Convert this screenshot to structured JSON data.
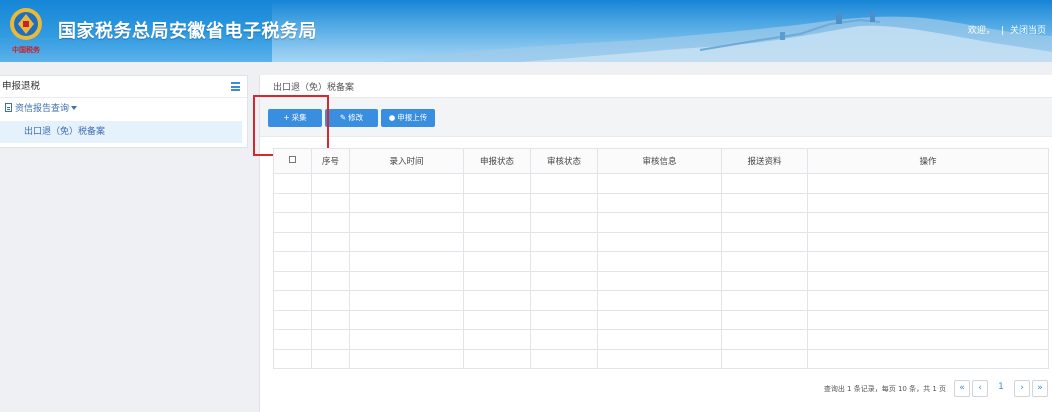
{
  "header": {
    "site_title": "国家税务总局安徽省电子税务局",
    "welcome": "欢迎，",
    "separator": "|",
    "close_page": "关闭当页",
    "brand_color": "#1585d6"
  },
  "sidebar": {
    "title": "申报退税",
    "menu_icon": "hamburger-icon",
    "group": {
      "label": "资信报告查询",
      "icon": "document-icon"
    },
    "items": [
      {
        "label": "出口退（免）税备案"
      }
    ]
  },
  "main": {
    "breadcrumb": "出口退（免）税备案",
    "toolbar": {
      "collect": {
        "icon": "plus-icon",
        "label": "采集"
      },
      "edit": {
        "icon": "edit-icon",
        "label": "修改"
      },
      "upload": {
        "icon": "user-icon",
        "label": "申报上传"
      }
    },
    "table": {
      "columns": [
        "序号",
        "录入时间",
        "申报状态",
        "审核状态",
        "审核信息",
        "报送资料",
        "操作"
      ],
      "rows": [
        [],
        [],
        [],
        [],
        [],
        [],
        [],
        [],
        [],
        []
      ]
    },
    "pagination": {
      "summary": "查询出 1 条记录，每页 10 条，共 1 页",
      "first": "«",
      "prev": "‹",
      "current": "1",
      "next": "›",
      "last": "»"
    },
    "accent_color": "#3a8ee0",
    "highlight_color": "#d9272e"
  }
}
